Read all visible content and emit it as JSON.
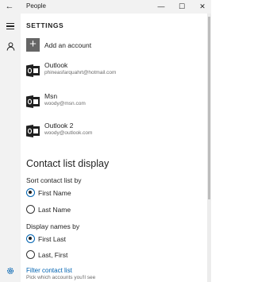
{
  "window": {
    "title": "People",
    "back_glyph": "←",
    "minimize_glyph": "—",
    "maximize_glyph": "☐",
    "close_glyph": "✕"
  },
  "settings": {
    "header": "SETTINGS",
    "add_account": {
      "plus": "+",
      "label": "Add an account"
    },
    "accounts": [
      {
        "name": "Outlook",
        "email": "phineasfarquahrt@hotmail.com"
      },
      {
        "name": "Msn",
        "email": "woody@msn.com"
      },
      {
        "name": "Outlook 2",
        "email": "woody@outlook.com"
      }
    ],
    "contact_list_display": {
      "title": "Contact list display",
      "sort_label": "Sort contact list by",
      "sort_options": [
        {
          "label": "First Name",
          "checked": true
        },
        {
          "label": "Last Name",
          "checked": false
        }
      ],
      "display_label": "Display names by",
      "display_options": [
        {
          "label": "First Last",
          "checked": true
        },
        {
          "label": "Last, First",
          "checked": false
        }
      ]
    },
    "filter": {
      "link": "Filter contact list",
      "subtext": "Pick which accounts you'll see"
    }
  },
  "colors": {
    "accent": "#0063b1",
    "outlook_icon": "#1f1f1f"
  },
  "icons": [
    "back-arrow-icon",
    "hamburger-icon",
    "person-icon",
    "gear-icon",
    "plus-icon",
    "outlook-icon"
  ]
}
